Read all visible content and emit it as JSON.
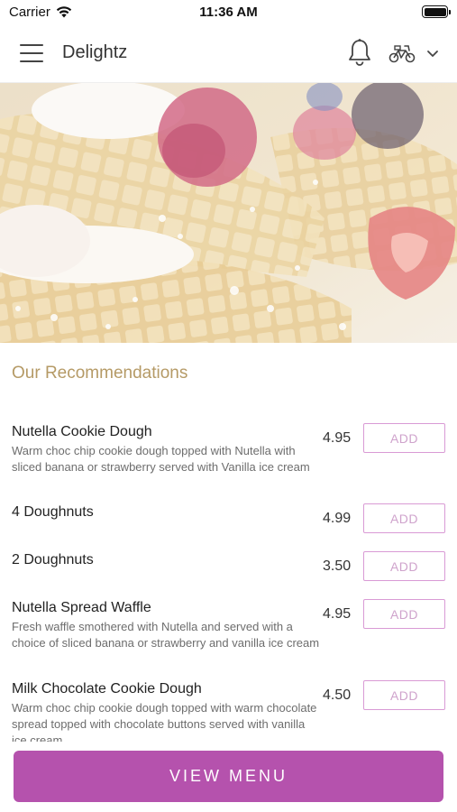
{
  "status_bar": {
    "carrier": "Carrier",
    "time": "11:36 AM",
    "icons": [
      "wifi-icon",
      "battery-icon"
    ]
  },
  "header": {
    "title": "Delightz",
    "icons": [
      "menu-icon",
      "bell-icon",
      "delivery-scooter-icon",
      "chevron-down-icon"
    ]
  },
  "hero": {
    "description_icon": "hero-image"
  },
  "recommendations": {
    "title": "Our Recommendations",
    "add_label": "ADD",
    "items": [
      {
        "name": "Nutella Cookie Dough",
        "description": "Warm choc chip cookie dough topped with Nutella with sliced banana or strawberry served with Vanilla ice cream",
        "price": "4.95"
      },
      {
        "name": "4 Doughnuts",
        "description": "",
        "price": "4.99"
      },
      {
        "name": "2 Doughnuts",
        "description": "",
        "price": "3.50"
      },
      {
        "name": "Nutella Spread Waffle",
        "description": "Fresh waffle smothered with Nutella and served with a choice of sliced banana or strawberry and vanilla ice cream",
        "price": "4.95"
      },
      {
        "name": "Milk Chocolate Cookie Dough",
        "description": "Warm choc chip cookie dough topped with warm chocolate spread topped with chocolate buttons served with vanilla ice cream",
        "price": "4.50"
      }
    ]
  },
  "footer": {
    "view_menu_label": "VIEW MENU"
  },
  "colors": {
    "accent": "#b552ad",
    "section_title": "#b59a66",
    "add_border": "#d99ad5"
  }
}
